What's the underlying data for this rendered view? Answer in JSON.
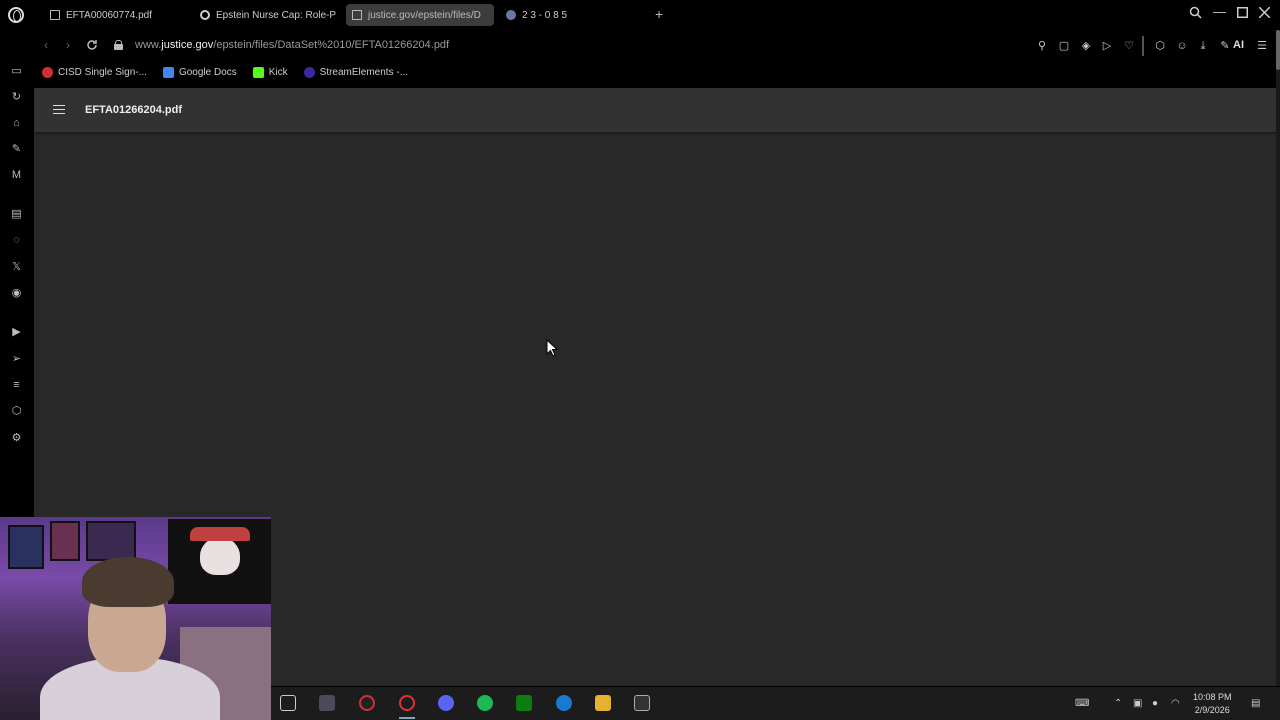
{
  "tabs": [
    {
      "title": "EFTA00060774.pdf",
      "icon": "document-icon"
    },
    {
      "title": "Epstein Nurse Cap: Role-P",
      "icon": "reload-icon"
    },
    {
      "title": "justice.gov/epstein/files/D",
      "icon": "document-icon",
      "active": true
    },
    {
      "title": "2 3 - 0 8 5",
      "icon": "globe-icon"
    }
  ],
  "address": {
    "prefix": "www.",
    "host": "justice.gov",
    "path": "/epstein/files/DataSet%2010/EFTA01266204.pdf"
  },
  "toolbar": {
    "ai_label": "AI"
  },
  "bookmarks": [
    {
      "label": "CISD Single Sign-...",
      "color": "#d03030"
    },
    {
      "label": "Google Docs",
      "color": "#4285f4"
    },
    {
      "label": "Kick",
      "color": "#53fc18"
    },
    {
      "label": "StreamElements -...",
      "color": "#3a2aa0"
    }
  ],
  "viewer": {
    "title": "EFTA01266204.pdf"
  },
  "clock": {
    "time": "10:08 PM",
    "date": "2/9/2026"
  }
}
